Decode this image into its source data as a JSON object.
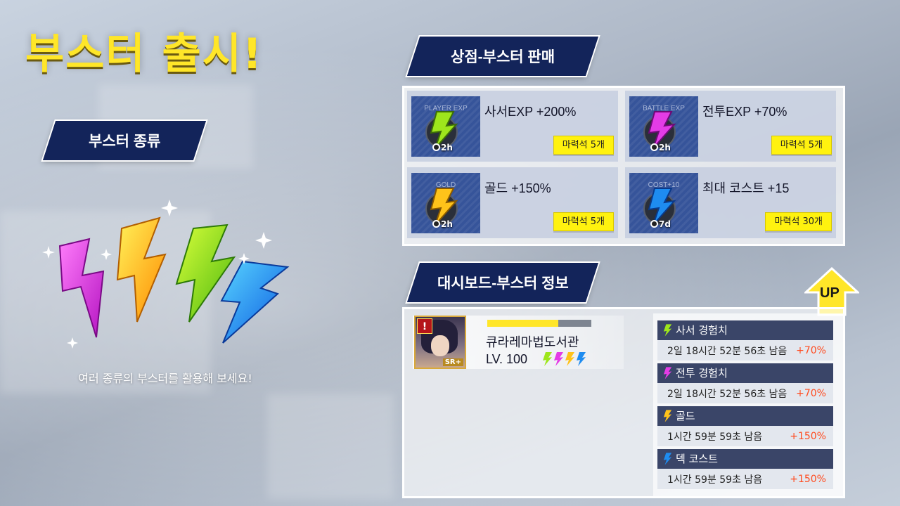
{
  "title": "부스터 출시!",
  "left": {
    "banner": "부스터 종류",
    "subtitle": "여러 종류의 부스터를 활용해 보세요!"
  },
  "shop": {
    "banner": "상점-부스터 판매",
    "items": [
      {
        "category": "PLAYER EXP",
        "name": "사서EXP +200%",
        "duration": "2h",
        "price": "마력석 5개",
        "color": "#9ee61c"
      },
      {
        "category": "BATTLE EXP",
        "name": "전투EXP +70%",
        "duration": "2h",
        "price": "마력석 5개",
        "color": "#e43ce6"
      },
      {
        "category": "GOLD",
        "name": "골드 +150%",
        "duration": "2h",
        "price": "마력석 5개",
        "color": "#ffc31a"
      },
      {
        "category": "COST+10",
        "name": "최대 코스트 +15",
        "duration": "7d",
        "price": "마력석 30개",
        "color": "#1e8cf0"
      }
    ]
  },
  "dashboard": {
    "banner": "대시보드-부스터 정보",
    "character": {
      "name": "큐라레마법도서관",
      "level": "LV. 100",
      "rank": "SR+",
      "alert": "!",
      "exp_fraction": 0.68
    },
    "boosts": [
      {
        "name": "사서 경험치",
        "remaining": "2일 18시간 52분 56초 남음",
        "bonus": "+70%",
        "color": "#9ee61c"
      },
      {
        "name": "전투 경험치",
        "remaining": "2일 18시간 52분 56초 남음",
        "bonus": "+70%",
        "color": "#e43ce6"
      },
      {
        "name": "골드",
        "remaining": "1시간 59분 59초 남음",
        "bonus": "+150%",
        "color": "#ffc31a"
      },
      {
        "name": "덱 코스트",
        "remaining": "1시간 59분 59초 남음",
        "bonus": "+150%",
        "color": "#1e8cf0"
      }
    ],
    "up_label": "UP"
  }
}
